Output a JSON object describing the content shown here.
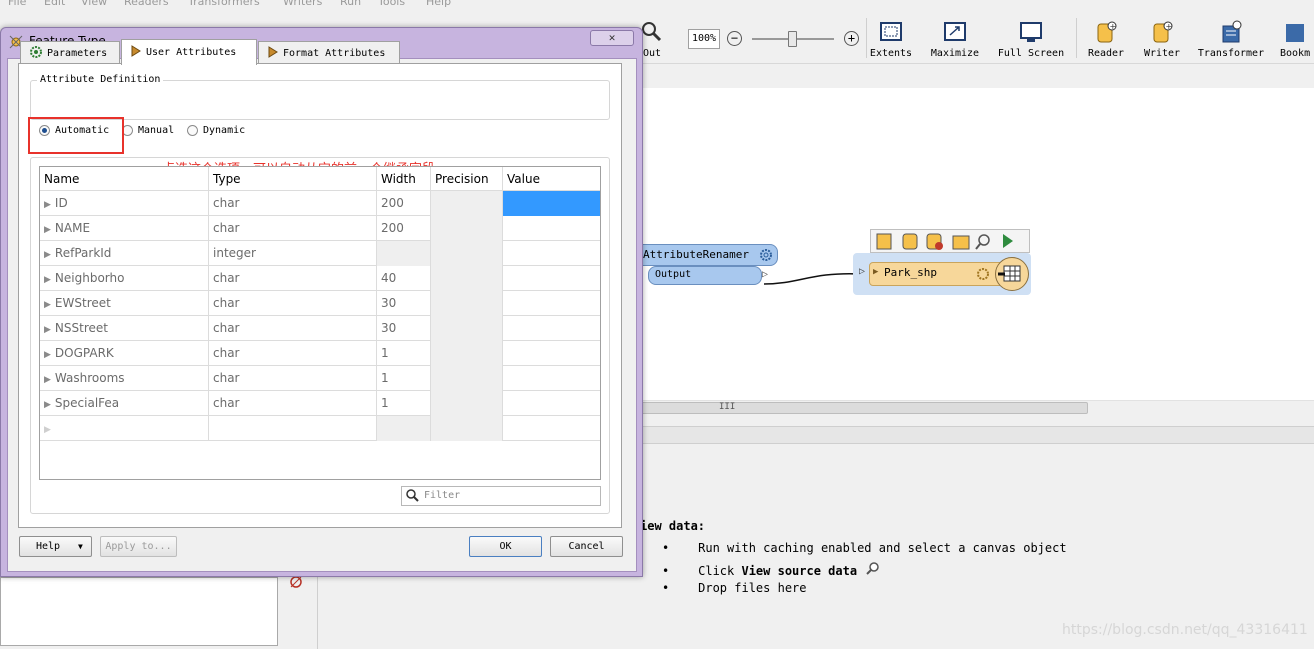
{
  "menu": [
    "File",
    "Edit",
    "View",
    "Readers",
    "Transformers",
    "Writers",
    "Run",
    "Tools",
    "Help"
  ],
  "toolbar": {
    "zoom_out_label": "Out",
    "zoom_value": "100%",
    "zoom_minus": "−",
    "zoom_plus": "+",
    "extents": "Extents",
    "maximize": "Maximize",
    "full_screen": "Full Screen",
    "reader": "Reader",
    "writer": "Writer",
    "transformer": "Transformer",
    "bookmark": "Bookm"
  },
  "canvas": {
    "renamer_title": "AttributeRenamer",
    "renamer_port": "Output",
    "writer_name": "Park_shp",
    "scroll_grip": "III"
  },
  "dialog": {
    "title": "Feature Type",
    "close": "✕",
    "tabs": [
      "Parameters",
      "User Attributes",
      "Format Attributes"
    ],
    "active_tab": 1,
    "group_label": "Attribute Definition",
    "radios": [
      {
        "label": "Automatic",
        "checked": true
      },
      {
        "label": "Manual",
        "checked": false
      },
      {
        "label": "Dynamic",
        "checked": false
      }
    ],
    "annotation": "点选这个选项，可以自动从它的前一个继承字段",
    "columns": [
      "Name",
      "Type",
      "Width",
      "Precision",
      "Value"
    ],
    "rows": [
      {
        "name": "ID",
        "type": "char",
        "width": "200"
      },
      {
        "name": "NAME",
        "type": "char",
        "width": "200"
      },
      {
        "name": "RefParkId",
        "type": "integer",
        "width": ""
      },
      {
        "name": "Neighborho",
        "type": "char",
        "width": "40"
      },
      {
        "name": "EWStreet",
        "type": "char",
        "width": "30"
      },
      {
        "name": "NSStreet",
        "type": "char",
        "width": "30"
      },
      {
        "name": "DOGPARK",
        "type": "char",
        "width": "1"
      },
      {
        "name": "Washrooms",
        "type": "char",
        "width": "1"
      },
      {
        "name": "SpecialFea",
        "type": "char",
        "width": "1"
      }
    ],
    "filter_placeholder": "Filter",
    "help": "Help",
    "apply_to": "Apply to...",
    "ok": "OK",
    "cancel": "Cancel"
  },
  "info": {
    "heading": "iew data:",
    "items": [
      "Run with caching enabled and select a canvas object",
      "Click",
      "Drop files here"
    ],
    "view_source_bold": "View source data"
  },
  "watermark": "https://blog.csdn.net/qq_43316411",
  "colors": {
    "selection": "#3399ff",
    "annotation": "#e8322b",
    "dialog_frame": "#c7b4df"
  }
}
